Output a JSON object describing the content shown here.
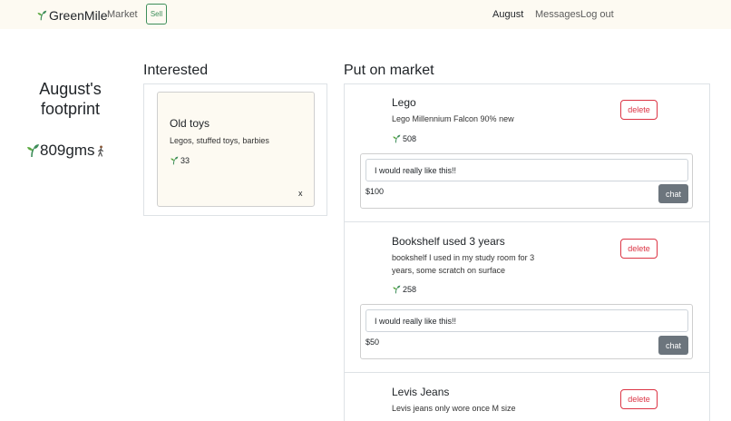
{
  "nav": {
    "brand": "GreenMile",
    "market": "Market",
    "sell": "Sell",
    "user": "August",
    "messages": "Messages",
    "logout": "Log out"
  },
  "footprint": {
    "title": "August's footprint",
    "amount": "809gms"
  },
  "interested": {
    "heading": "Interested",
    "items": [
      {
        "title": "Old toys",
        "description": "Legos, stuffed toys, barbies",
        "score": "33",
        "remove": "x"
      }
    ]
  },
  "market": {
    "heading": "Put on market",
    "items": [
      {
        "title": "Lego",
        "description": "Lego Millennium Falcon 90% new",
        "score": "508",
        "delete": "delete",
        "message": "I would really like this!!",
        "price": "$100",
        "chat": "chat"
      },
      {
        "title": "Bookshelf used 3 years",
        "description": "bookshelf I used in my study room for 3 years, some scratch on surface",
        "score": "258",
        "delete": "delete",
        "message": "I would really like this!!",
        "price": "$50",
        "chat": "chat"
      },
      {
        "title": "Levis Jeans",
        "description": "Levis jeans only wore once M size",
        "delete": "delete"
      }
    ]
  },
  "colors": {
    "navbar_bg": "#fdfaf2",
    "accent_green": "#3e8e5a",
    "danger": "#dc3545",
    "chat_button": "#6c757d"
  }
}
